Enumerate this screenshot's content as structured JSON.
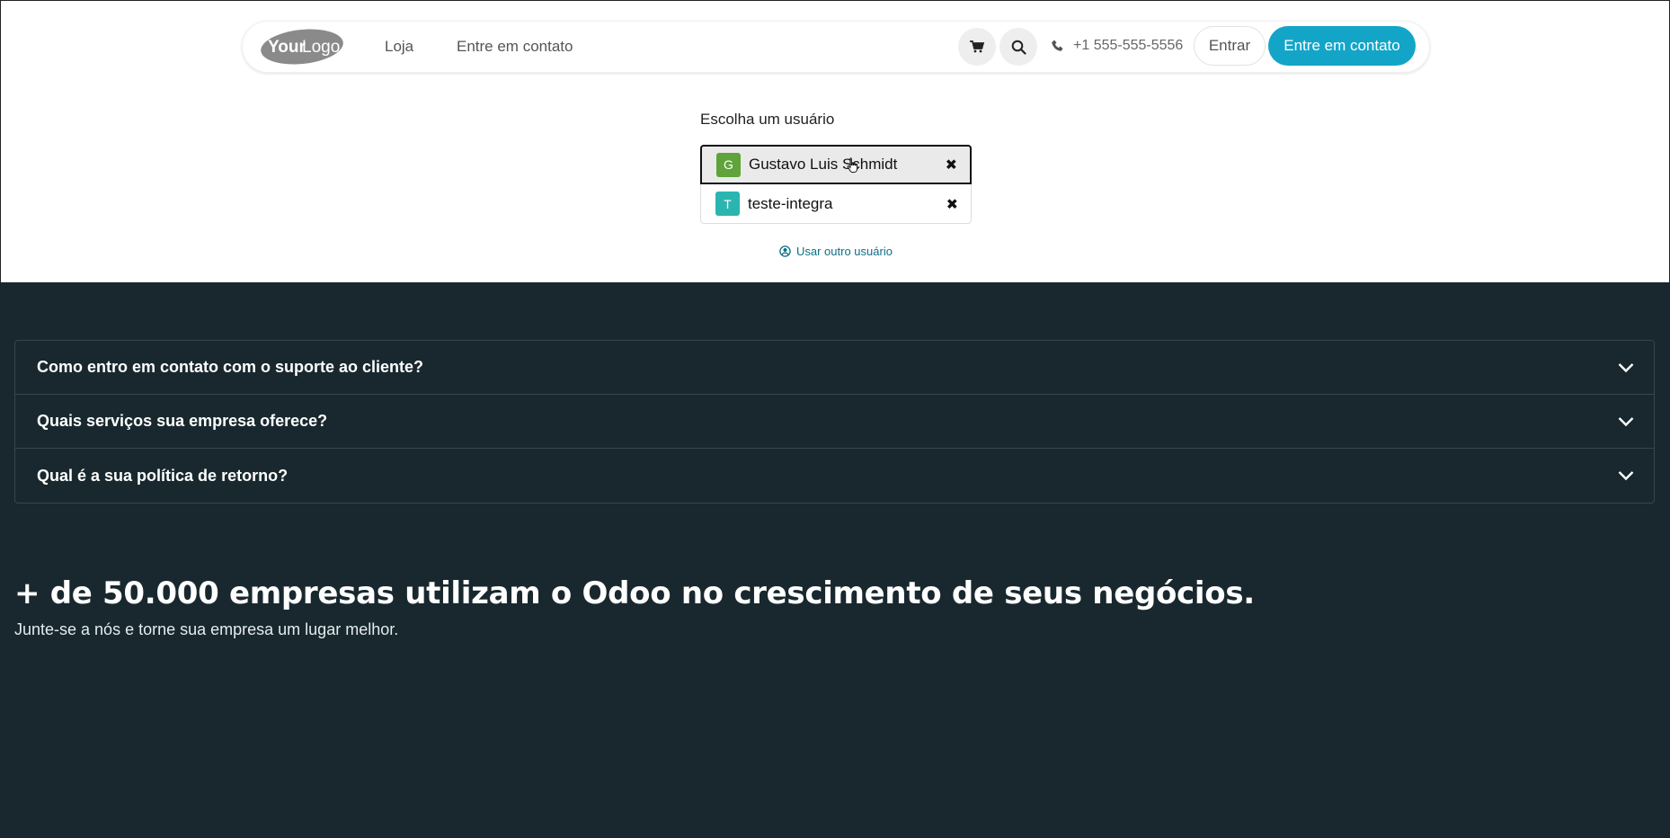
{
  "header": {
    "logo_text_bold": "Your",
    "logo_text_light": "Logo",
    "nav": [
      "Loja",
      "Entre em contato"
    ],
    "phone": "+1 555-555-5556",
    "login_label": "Entrar",
    "cta_label": "Entre em contato",
    "cta_color": "#13a5c7"
  },
  "chooser": {
    "label": "Escolha um usuário",
    "users": [
      {
        "initial": "G",
        "name": "Gustavo Luis Schmidt",
        "avatar_color": "#5fa33a"
      },
      {
        "initial": "T",
        "name": "teste-integra",
        "avatar_color": "#2bb5b1"
      }
    ],
    "other_user_label": "Usar outro usuário"
  },
  "faq": [
    "Como entro em contato com o suporte ao cliente?",
    "Quais serviços sua empresa oferece?",
    "Qual é a sua política de retorno?"
  ],
  "cta_section": {
    "headline": "+ de 50.000 empresas utilizam o Odoo no crescimento de seus negócios.",
    "subline": "Junte-se a nós e torne sua empresa um lugar melhor."
  },
  "colors": {
    "dark_bg": "#18282e",
    "link": "#0d6f86"
  }
}
